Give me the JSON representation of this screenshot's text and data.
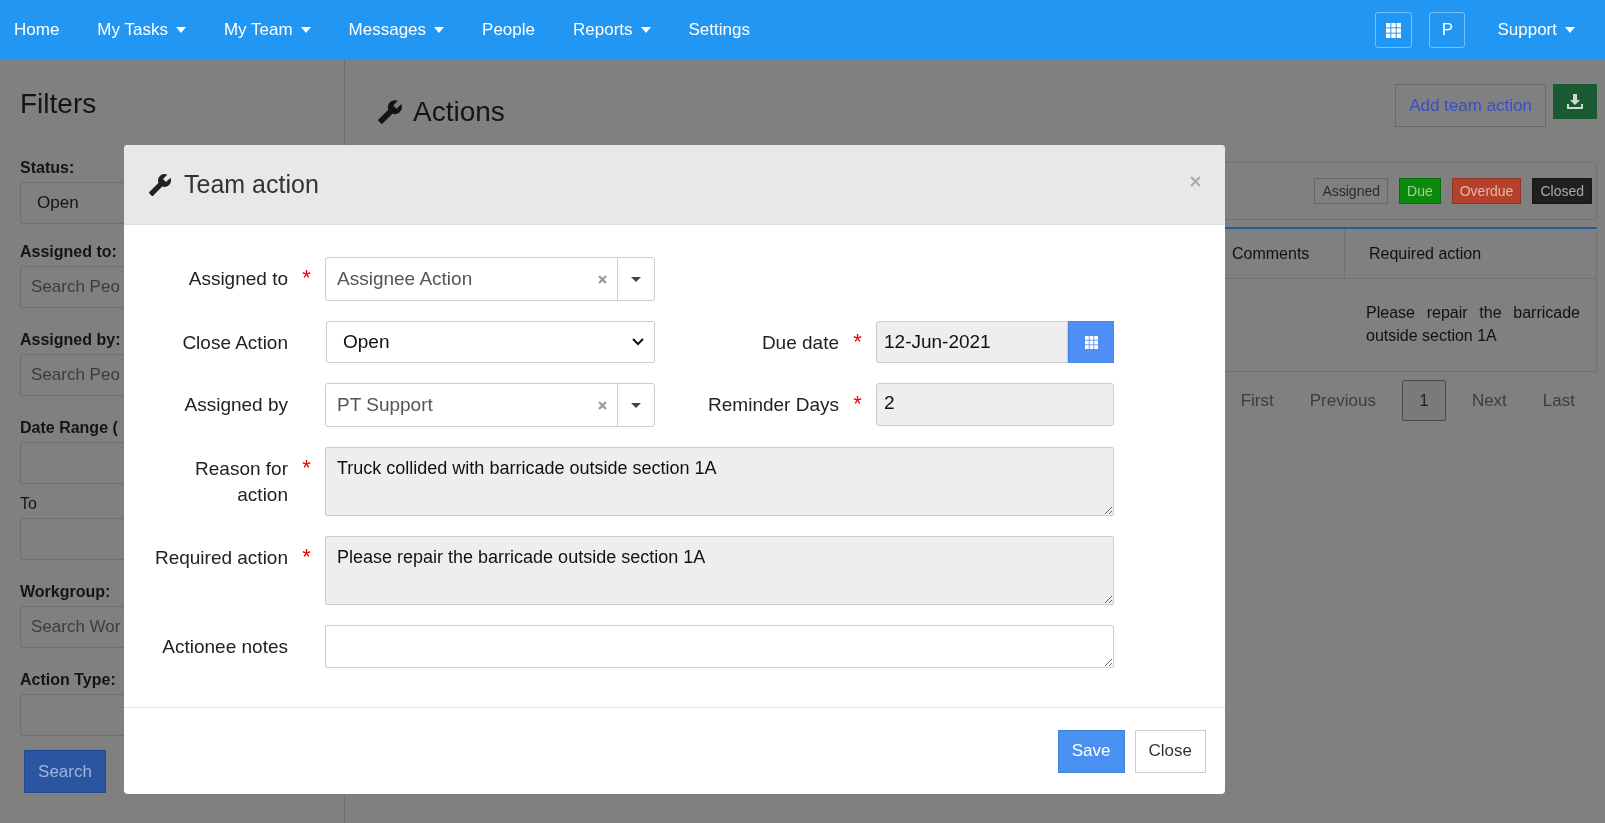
{
  "nav": {
    "items": [
      {
        "label": "Home",
        "dropdown": false
      },
      {
        "label": "My Tasks",
        "dropdown": true
      },
      {
        "label": "My Team",
        "dropdown": true
      },
      {
        "label": "Messages",
        "dropdown": true
      },
      {
        "label": "People",
        "dropdown": false
      },
      {
        "label": "Reports",
        "dropdown": true
      },
      {
        "label": "Settings",
        "dropdown": false
      }
    ],
    "user_button": "P",
    "support": {
      "label": "Support",
      "dropdown": true
    }
  },
  "filters": {
    "title": "Filters",
    "fields": [
      {
        "label": "Status:",
        "kind": "select",
        "value": "Open"
      },
      {
        "label": "Assigned to:",
        "kind": "search",
        "placeholder": "Search Peo"
      },
      {
        "label": "Assigned by:",
        "kind": "search",
        "placeholder": "Search Peo"
      },
      {
        "label": "Date Range (",
        "kind": "date"
      },
      {
        "label": "To",
        "kind": "date",
        "sublabel": true
      },
      {
        "label": "Workgroup:",
        "kind": "search",
        "placeholder": "Search Wor"
      },
      {
        "label": "Action Type:",
        "kind": "search"
      }
    ],
    "search_button": "Search"
  },
  "actions": {
    "title": "Actions",
    "add_button": "Add team action",
    "legend": [
      {
        "label": "Assigned",
        "color": "#808080"
      },
      {
        "label": "Due",
        "color": "#0b8a0b"
      },
      {
        "label": "Overdue",
        "color": "#b5412c"
      },
      {
        "label": "Closed",
        "color": "#1f1f1f"
      }
    ],
    "table": {
      "columns": [
        "Comments",
        "Required action"
      ],
      "rows": [
        {
          "required_action": "Please repair the barricade outside section 1A"
        }
      ]
    },
    "pagination": [
      {
        "label": "First",
        "selected": false
      },
      {
        "label": "Previous",
        "selected": false
      },
      {
        "label": "1",
        "selected": true
      },
      {
        "label": "Next",
        "selected": false
      },
      {
        "label": "Last",
        "selected": false
      }
    ]
  },
  "modal": {
    "title": "Team action",
    "rows": [
      {
        "fields": [
          {
            "label": "Assigned to",
            "required_mark": "*",
            "kind": "select2",
            "value": "Assignee Action"
          }
        ]
      },
      {
        "fields": [
          {
            "label": "Close Action",
            "kind": "select",
            "value": "Open"
          },
          {
            "label": "Due date",
            "required_mark": "*",
            "kind": "date",
            "value": "12-Jun-2021"
          }
        ]
      },
      {
        "fields": [
          {
            "label": "Assigned by",
            "kind": "select2",
            "value": "PT Support"
          },
          {
            "label": "Reminder Days",
            "required_mark": "*",
            "kind": "text",
            "value": "2"
          }
        ]
      },
      {
        "fields": [
          {
            "label": "Reason for action",
            "required_mark": "*",
            "kind": "textarea",
            "value": "Truck collided with barricade outside section 1A",
            "readonly": true
          }
        ]
      },
      {
        "fields": [
          {
            "label": "Required action",
            "required_mark": "*",
            "kind": "textarea",
            "value": "Please repair the barricade outside section 1A",
            "readonly": true
          }
        ]
      },
      {
        "fields": [
          {
            "label": "Actionee notes",
            "kind": "textarea",
            "readonly": false
          }
        ]
      }
    ],
    "buttons": [
      {
        "label": "Save",
        "primary": true
      },
      {
        "label": "Close",
        "primary": false
      }
    ]
  }
}
